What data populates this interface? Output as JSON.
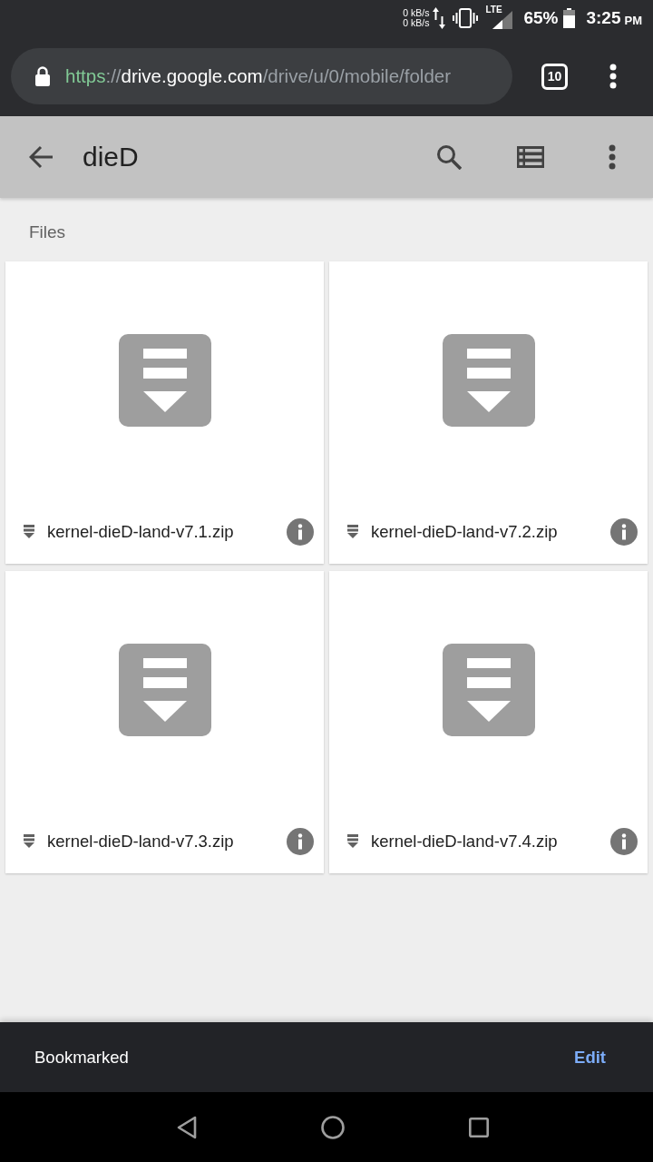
{
  "status_bar": {
    "upload_speed": "0 kB/s",
    "download_speed": "0 kB/s",
    "network": "LTE",
    "battery": "65%",
    "time": "3:25",
    "meridiem": "PM"
  },
  "browser_toolbar": {
    "url": {
      "scheme": "https",
      "separator": "://",
      "host": "drive.google.com",
      "path": "/drive/u/0/mobile/folder"
    },
    "tab_count": "10"
  },
  "app_bar": {
    "title": "dieD"
  },
  "section": {
    "title": "Files"
  },
  "files": [
    {
      "name": "kernel-dieD-land-v7.1.zip"
    },
    {
      "name": "kernel-dieD-land-v7.2.zip"
    },
    {
      "name": "kernel-dieD-land-v7.3.zip"
    },
    {
      "name": "kernel-dieD-land-v7.4.zip"
    }
  ],
  "bookmark_bar": {
    "label": "Bookmarked",
    "action": "Edit"
  }
}
